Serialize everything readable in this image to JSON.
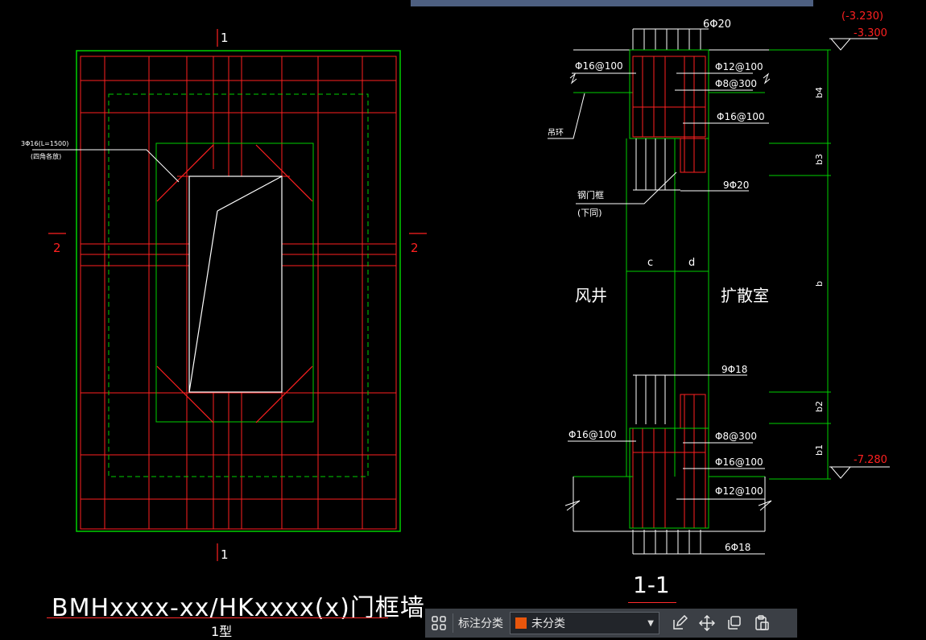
{
  "left_plan": {
    "cut_label_1": "1",
    "cut_label_2": "2",
    "rebar_note_line1": "3Φ16(L=1500)",
    "rebar_note_line2": "(四角各放)"
  },
  "section": {
    "top_bars": "6Φ20",
    "level_top_paren": "(-3.230)",
    "level_top": "-3.300",
    "level_bottom": "-7.280",
    "bar_16_100_a": "Φ16@100",
    "bar_12_100_a": "Φ12@100",
    "bar_8_300_a": "Φ8@300",
    "bar_16_100_b": "Φ16@100",
    "hook_label": "吊环",
    "bars_9_20": "9Φ20",
    "door_frame_label_1": "钢门框",
    "door_frame_label_2": "(下同)",
    "dim_c": "c",
    "dim_d": "d",
    "room_left": "风井",
    "room_right": "扩散室",
    "bars_9_18": "9Φ18",
    "bar_16_100_c": "Φ16@100",
    "bar_8_300_b": "Φ8@300",
    "bar_16_100_d": "Φ16@100",
    "bar_12_100_b": "Φ12@100",
    "bottom_bars": "6Φ18",
    "dim_b4": "b4",
    "dim_b3": "b3",
    "dim_b": "b",
    "dim_b2": "b2",
    "dim_b1": "b1"
  },
  "titles": {
    "main_title": "BMHxxxx-xx/HKxxxx(x)门框墙",
    "subtitle": "1型",
    "section_title": "1-1"
  },
  "toolbar": {
    "grid_icon": "grid-icon",
    "category_label": "标注分类",
    "category_value": "未分类",
    "category_color": "#e8560c",
    "edit_icon": "edit-icon",
    "move_icon": "move-icon",
    "copy_icon": "copy-icon",
    "paste_icon": "paste-icon"
  },
  "colors": {
    "background": "#000000",
    "green": "#00d000",
    "red": "#ff2020",
    "white": "#ffffff",
    "toolbar": "#3b3f45"
  }
}
